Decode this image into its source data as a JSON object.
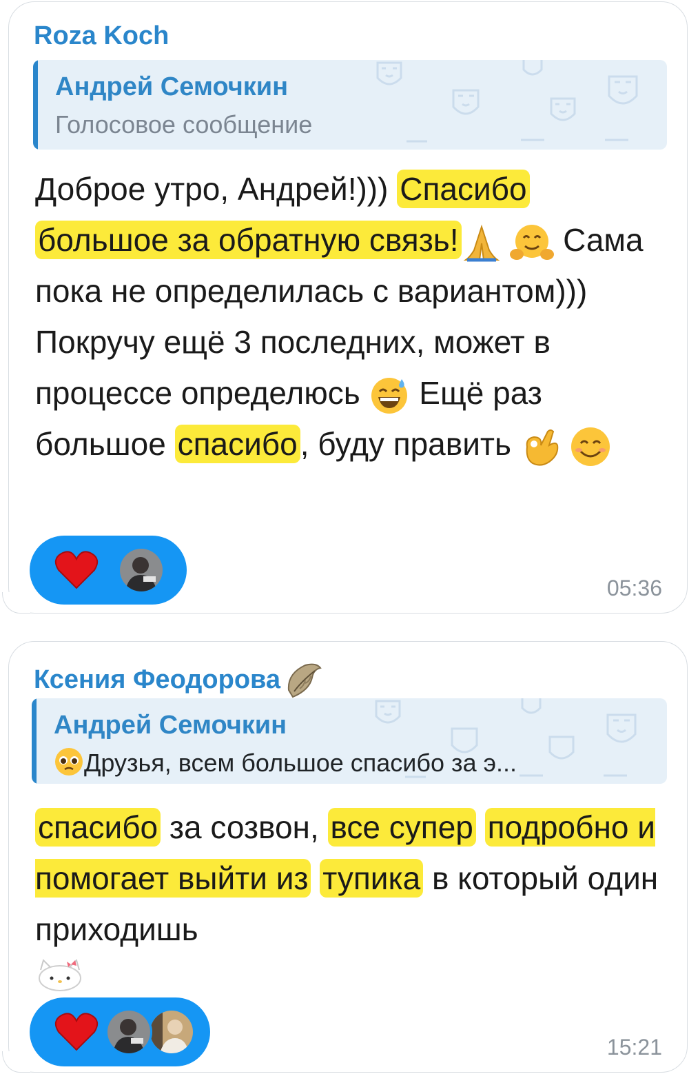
{
  "colors": {
    "sender_name": "#2a86cb",
    "reply_bar": "#2a86cb",
    "reply_bg": "#e6f0f8",
    "highlight": "#fcea3a",
    "reaction_bg": "#1596f4",
    "timestamp": "#8b939b"
  },
  "messages": [
    {
      "sender": "Roza Koch",
      "reply": {
        "name": "Андрей Семочкин",
        "text": "Голосовое сообщение"
      },
      "body": {
        "p1": "Доброе утро, Андрей!))) ",
        "h1": "Спасибо",
        "h2": "большое за обратную связь!",
        "p2": " Сама пока не определилась с вариантом))) Покручу ещё 3 последних, может в процессе определюсь ",
        "p3": " Ещё раз большое ",
        "h3": "спасибо",
        "p4": ", буду править "
      },
      "emojis": [
        "folded-hands-icon",
        "hugging-face-icon",
        "grinning-sweat-icon",
        "ok-hand-icon",
        "smiling-face-icon"
      ],
      "reactions": {
        "emoji": "heart-icon",
        "avatars": 1
      },
      "time": "05:36"
    },
    {
      "sender": "Ксения Феодорова",
      "sender_badge": "moth-icon",
      "reply": {
        "name": "Андрей Семочкин",
        "emoji": "pleading-face-icon",
        "text": "Друзья, всем большое спасибо за э..."
      },
      "body": {
        "h1": "спасибо",
        "p1": " за созвон, ",
        "h2": "все супер",
        "h3": "подробно и помогает выйти из",
        "h4": "тупика",
        "p2": " в который один приходишь"
      },
      "sticker": "hello-kitty-icon",
      "reactions": {
        "emoji": "heart-icon",
        "avatars": 2
      },
      "time": "15:21"
    }
  ]
}
